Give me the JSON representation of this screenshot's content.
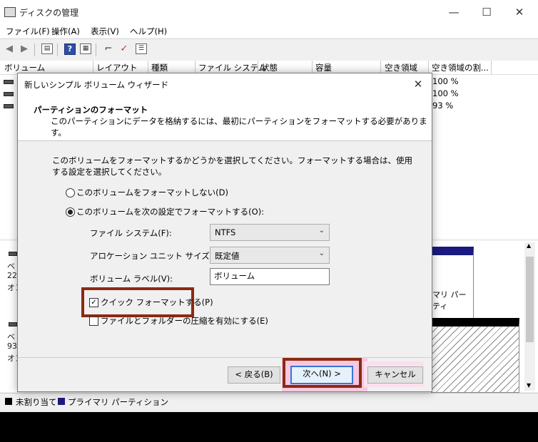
{
  "window": {
    "title": "ディスクの管理",
    "minimize": "—",
    "maximize": "☐",
    "close": "✕"
  },
  "menu": [
    "ファイル(F)",
    "操作(A)",
    "表示(V)",
    "ヘルプ(H)"
  ],
  "toolbar": {
    "back_icon": "◀",
    "forward_icon": "▶",
    "help_glyph": "?"
  },
  "volume_list": {
    "columns": [
      "ボリューム",
      "レイアウト",
      "種類",
      "ファイル システム",
      "状態",
      "容量",
      "空き領域",
      "空き領域の割..."
    ],
    "free_pct": [
      "100 %",
      "100 %",
      "93 %"
    ]
  },
  "graphical_view": {
    "disk_labels": [
      [
        "ベ",
        "22",
        "オン"
      ],
      [
        "ベ",
        "93",
        "オン"
      ]
    ],
    "partition_text": "マリ パーティ"
  },
  "legend": {
    "unallocated": "未割り当て",
    "primary": "プライマリ パーティション",
    "unallocated_color": "#000000",
    "primary_color": "#1a1a80"
  },
  "dialog": {
    "title": "新しいシンプル ボリューム ウィザード",
    "close": "✕",
    "heading": "パーティションのフォーマット",
    "subheading": "このパーティションにデータを格納するには、最初にパーティションをフォーマットする必要があります。",
    "intro": "このボリュームをフォーマットするかどうかを選択してください。フォーマットする場合は、使用する設定を選択してください。",
    "radio_no_format": "このボリュームをフォーマットしない(D)",
    "radio_format": "このボリュームを次の設定でフォーマットする(O):",
    "fs_label": "ファイル システム(F):",
    "fs_value": "NTFS",
    "alloc_label": "アロケーション ユニット サイズ(A):",
    "alloc_value": "既定値",
    "vol_label": "ボリューム ラベル(V):",
    "vol_value": "ボリューム",
    "quick_format": "クイック フォーマットする(P)",
    "quick_format_checked": true,
    "compress": "ファイルとフォルダーの圧縮を有効にする(E)",
    "compress_checked": false,
    "back_button": "< 戻る(B)",
    "next_button": "次へ(N) >",
    "cancel_button": "キャンセル",
    "highlight_color": "#8b2a12"
  }
}
